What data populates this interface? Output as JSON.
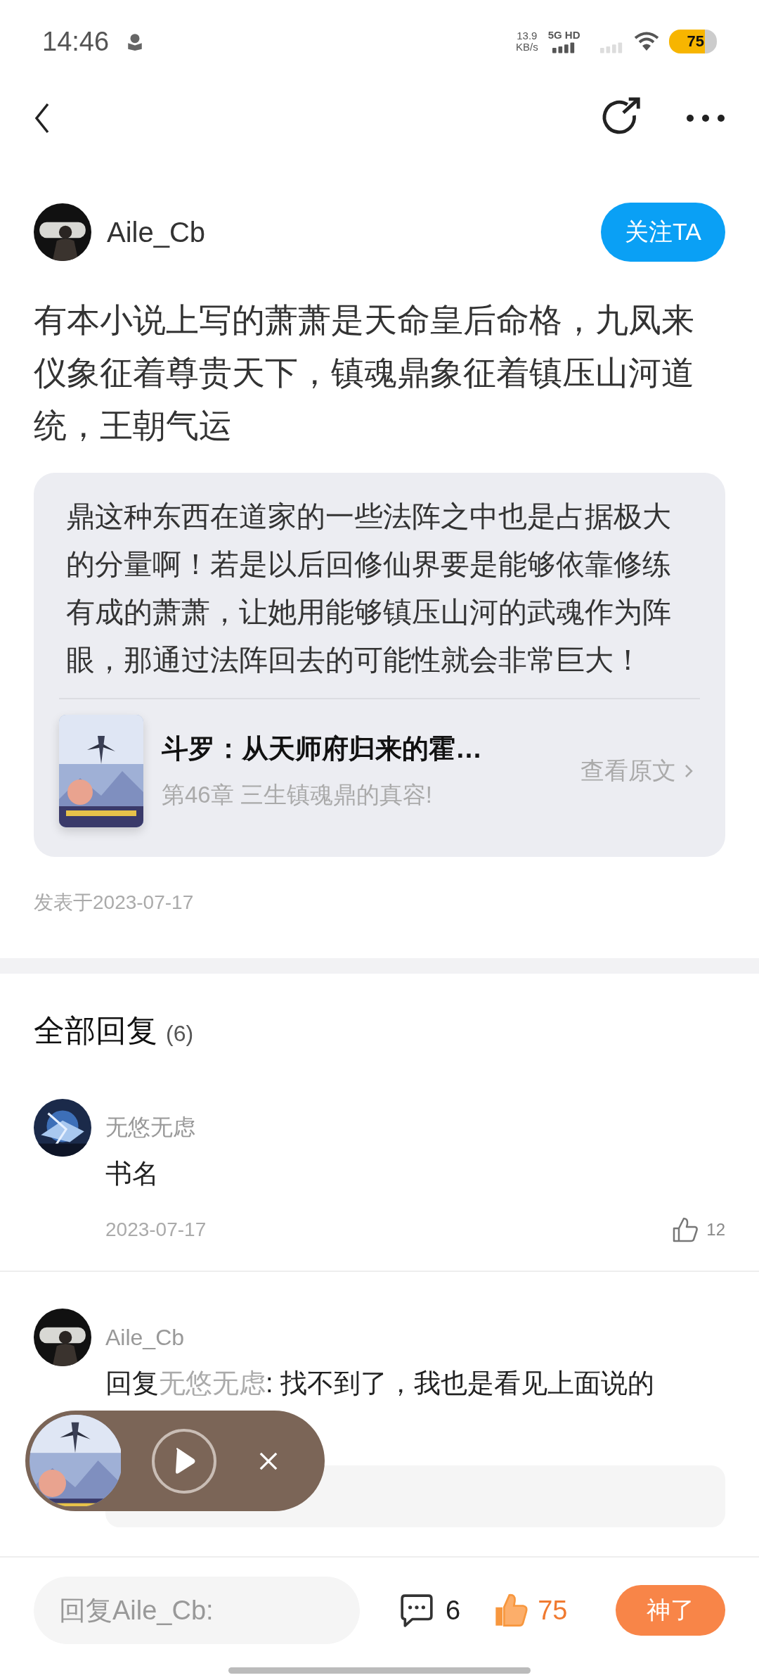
{
  "status_bar": {
    "time": "14:46",
    "speed": "13.9",
    "speed_unit": "KB/s",
    "network": "5G HD",
    "battery": "75"
  },
  "author": {
    "name": "Aile_Cb",
    "follow_label": "关注TA"
  },
  "post": {
    "text": "有本小说上写的萧萧是天命皇后命格，九凤来仪象征着尊贵天下，镇魂鼎象征着镇压山河道统，王朝气运",
    "quote": "鼎这种东西在道家的一些法阵之中也是占据极大的分量啊！若是以后回修仙界要是能够依靠修练有成的萧萧，让她用能够镇压山河的武魂作为阵眼，那通过法阵回去的可能性就会非常巨大！",
    "book": {
      "kind": "picture",
      "title": "斗罗：从天师府归来的霍…",
      "chapter": "第46章 三生镇魂鼎的真容!",
      "link": "查看原文"
    },
    "date": "发表于2023-07-17"
  },
  "replies_header": {
    "title": "全部回复",
    "count": "(6)"
  },
  "replies": [
    {
      "name": "无悠无虑",
      "text": "书名",
      "date": "2023-07-17",
      "likes": "12"
    },
    {
      "name": "Aile_Cb",
      "prefix": "回复",
      "mention": "无悠无虑",
      "text": ": 找不到了，我也是看见上面说的",
      "quoted": true
    }
  ],
  "bottom_bar": {
    "placeholder": "回复Aile_Cb:",
    "comments": "6",
    "likes": "75",
    "action": "神了"
  }
}
